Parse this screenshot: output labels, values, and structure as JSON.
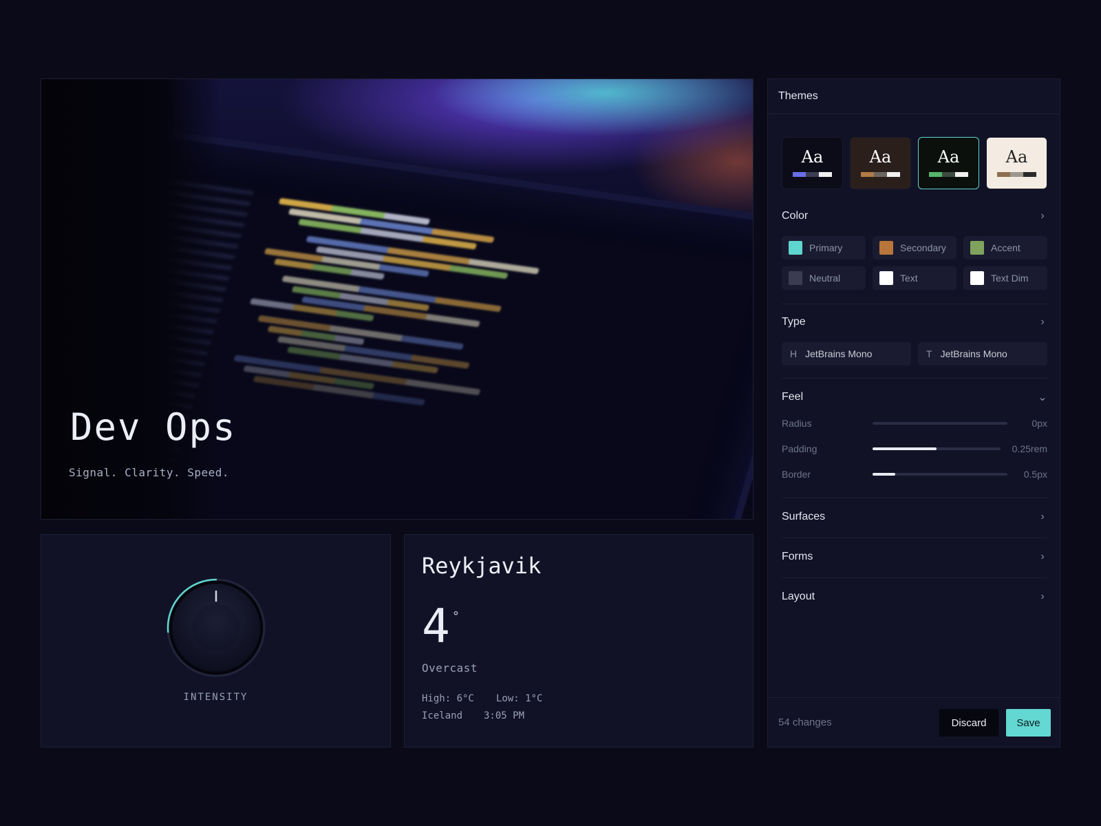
{
  "hero": {
    "title": "Dev Ops",
    "subtitle": "Signal. Clarity. Speed."
  },
  "knob": {
    "label": "INTENSITY",
    "level_percent": 12,
    "accent": "#5fd5cf"
  },
  "weather": {
    "city": "Reykjavik",
    "temperature": "4",
    "degree_symbol": "°",
    "condition": "Overcast",
    "high": "High: 6°C",
    "low": "Low: 1°C",
    "country": "Iceland",
    "time": "3:05 PM"
  },
  "panel": {
    "title": "Themes",
    "themes": [
      {
        "label": "Aa",
        "bg": "#0c0c18",
        "fg": "#ffffff",
        "swatches": [
          "#6a6ee6",
          "#3c3d52",
          "#f0f0f0"
        ],
        "selected": false
      },
      {
        "label": "Aa",
        "bg": "#2a1f1b",
        "fg": "#ffffff",
        "swatches": [
          "#b27a45",
          "#6b6560",
          "#f0f0f0"
        ],
        "selected": false
      },
      {
        "label": "Aa",
        "bg": "#0b100d",
        "fg": "#ffffff",
        "swatches": [
          "#56b46a",
          "#3d4a41",
          "#f0f0f0"
        ],
        "selected": true
      },
      {
        "label": "Aa",
        "bg": "#f4ece2",
        "fg": "#222222",
        "swatches": [
          "#8e6e50",
          "#9c968d",
          "#2a2a2a"
        ],
        "selected": false
      }
    ],
    "color": {
      "title": "Color",
      "items": [
        {
          "label": "Primary",
          "swatch": "#5fd5cf"
        },
        {
          "label": "Secondary",
          "swatch": "#b8763a"
        },
        {
          "label": "Accent",
          "swatch": "#7fa35d"
        },
        {
          "label": "Neutral",
          "swatch": "#3b3c52"
        },
        {
          "label": "Text",
          "swatch": "#ffffff"
        },
        {
          "label": "Text Dim",
          "swatch": "#ffffff"
        }
      ]
    },
    "type": {
      "title": "Type",
      "heading": {
        "glyph": "H",
        "font": "JetBrains Mono"
      },
      "body": {
        "glyph": "T",
        "font": "JetBrains Mono"
      }
    },
    "feel": {
      "title": "Feel",
      "sliders": [
        {
          "label": "Radius",
          "value": "0px",
          "fraction": 0.0
        },
        {
          "label": "Padding",
          "value": "0.25rem",
          "fraction": 0.5
        },
        {
          "label": "Border",
          "value": "0.5px",
          "fraction": 0.17
        }
      ]
    },
    "surfaces": {
      "title": "Surfaces"
    },
    "forms": {
      "title": "Forms"
    },
    "layout": {
      "title": "Layout"
    },
    "footer": {
      "changes": "54 changes",
      "discard": "Discard",
      "save": "Save"
    }
  }
}
